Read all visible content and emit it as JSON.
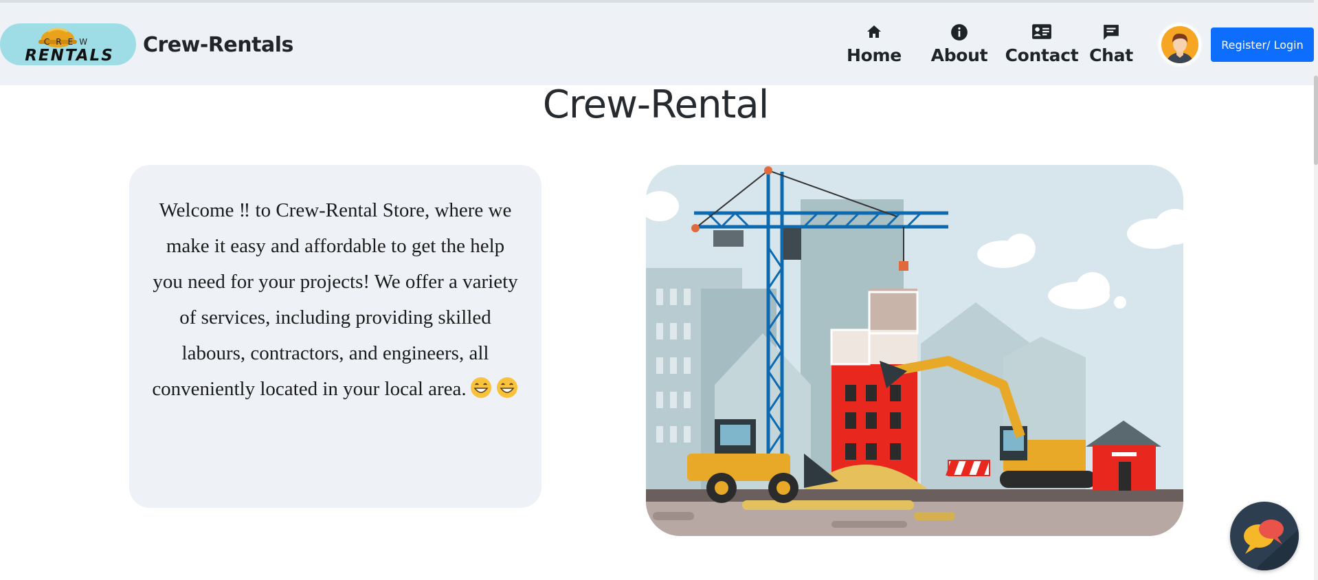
{
  "navbar": {
    "logo_text_top": "CREW",
    "logo_text_bottom": "RENTALS",
    "brand": "Crew-Rentals",
    "items": [
      {
        "label": "Home",
        "icon": "home-icon"
      },
      {
        "label": "About",
        "icon": "info-icon"
      },
      {
        "label": "Contact",
        "icon": "contact-card-icon"
      },
      {
        "label": "Chat",
        "icon": "chat-icon"
      }
    ],
    "register_label": "Register/ Login"
  },
  "main": {
    "title": "Crew-Rental",
    "welcome_text": "Welcome ‼ to Crew-Rental Store, where we make it easy and affordable to get the help you need for your projects! We offer a variety of services, including providing skilled labours, contractors, and engineers, all conveniently located in your local area."
  },
  "colors": {
    "navbar_bg": "#eef2f6",
    "button_primary": "#0d6efd",
    "card_bg": "#eef2f6",
    "logo_bg": "#9fdde6",
    "chat_fab_bg": "#2c3e50"
  }
}
